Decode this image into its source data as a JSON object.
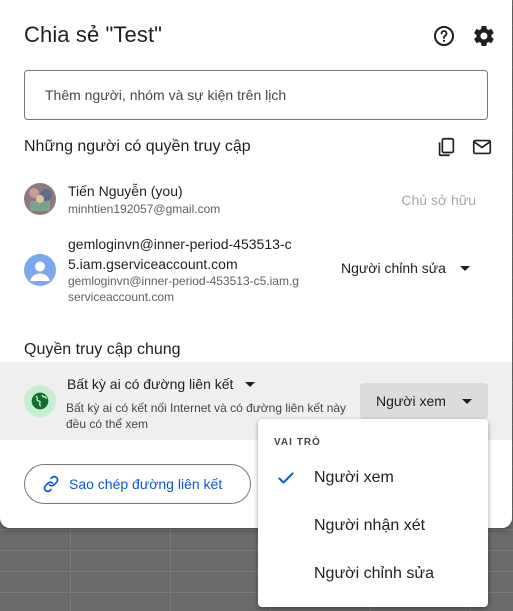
{
  "dialog": {
    "title": "Chia sẻ \"Test\"",
    "help_icon": "help-circle-icon",
    "settings_icon": "gear-icon"
  },
  "add_people": {
    "placeholder": "Thêm người, nhóm và sự kiện trên lịch"
  },
  "people_section": {
    "title": "Những người có quyền truy cập",
    "copy_icon": "copy-icon",
    "email_icon": "mail-icon",
    "people": [
      {
        "name": "Tiến Nguyễn (you)",
        "email": "minhtien192057@gmail.com",
        "role": "Chủ sở hữu"
      },
      {
        "name_line1": "gemloginvn@inner-period-453513-c",
        "name_line2": "5.iam.gserviceaccount.com",
        "email_line1": "gemloginvn@inner-period-453513-c5.iam.g",
        "email_line2": "serviceaccount.com",
        "role": "Người chỉnh sửa"
      }
    ]
  },
  "general_access": {
    "title": "Quyền truy cập chung",
    "access_type": "Bất kỳ ai có đường liên kết",
    "description": "Bất kỳ ai có kết nối Internet và có đường liên kết này đều có thể xem",
    "role": "Người xem"
  },
  "copy_link": {
    "label": "Sao chép đường liên kết"
  },
  "role_menu": {
    "header": "VAI TRÒ",
    "items": [
      {
        "label": "Người xem",
        "selected": true
      },
      {
        "label": "Người nhận xét",
        "selected": false
      },
      {
        "label": "Người chỉnh sửa",
        "selected": false
      }
    ]
  },
  "colors": {
    "accent": "#0b57d0",
    "globe_bg": "#c4eed0",
    "globe_icon": "#146c2e"
  }
}
